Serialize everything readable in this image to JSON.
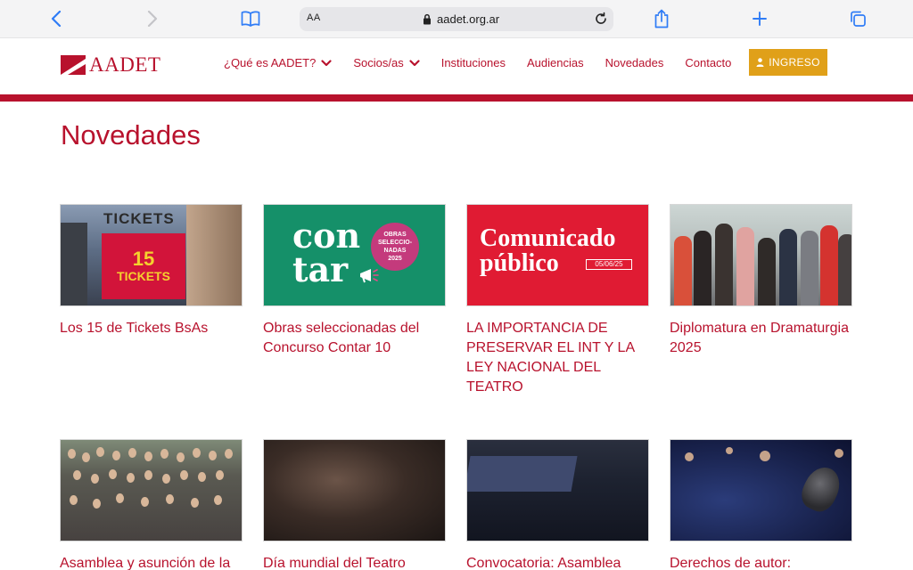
{
  "browser": {
    "text_size_label": "AA",
    "url": "aadet.org.ar"
  },
  "header": {
    "logo_text": "AADET",
    "nav": [
      {
        "label": "¿Qué es AADET?",
        "has_dropdown": true
      },
      {
        "label": "Socios/as",
        "has_dropdown": true
      },
      {
        "label": "Instituciones",
        "has_dropdown": false
      },
      {
        "label": "Audiencias",
        "has_dropdown": false
      },
      {
        "label": "Novedades",
        "has_dropdown": false
      },
      {
        "label": "Contacto",
        "has_dropdown": false
      }
    ],
    "login_label": "INGRESO"
  },
  "main": {
    "title": "Novedades",
    "cards": [
      {
        "title": "Los 15 de Tickets BsAs",
        "thumb_text": {
          "sign": "TICKETS",
          "num": "15",
          "word": "TICKETS"
        }
      },
      {
        "title": "Obras seleccionadas del Concurso Contar 10",
        "thumb_text": {
          "word": "con\ntar",
          "badge": [
            "OBRAS",
            "SELECCIO-",
            "NADAS",
            "2025"
          ]
        }
      },
      {
        "title": "LA IMPORTANCIA DE PRESERVAR EL INT Y LA LEY NACIONAL DEL TEATRO",
        "thumb_text": {
          "line1": "Comunicado",
          "line2": "público",
          "date": "05/06/25"
        }
      },
      {
        "title": "Diplomatura en Dramaturgia 2025"
      },
      {
        "title": "Asamblea y asunción de la"
      },
      {
        "title": "Día mundial del Teatro"
      },
      {
        "title": "Convocatoria: Asamblea"
      },
      {
        "title": "Derechos de autor:"
      }
    ]
  },
  "colors": {
    "brand_red": "#b8122d",
    "login_gold": "#e0a019",
    "safari_blue": "#2f7cf6"
  }
}
